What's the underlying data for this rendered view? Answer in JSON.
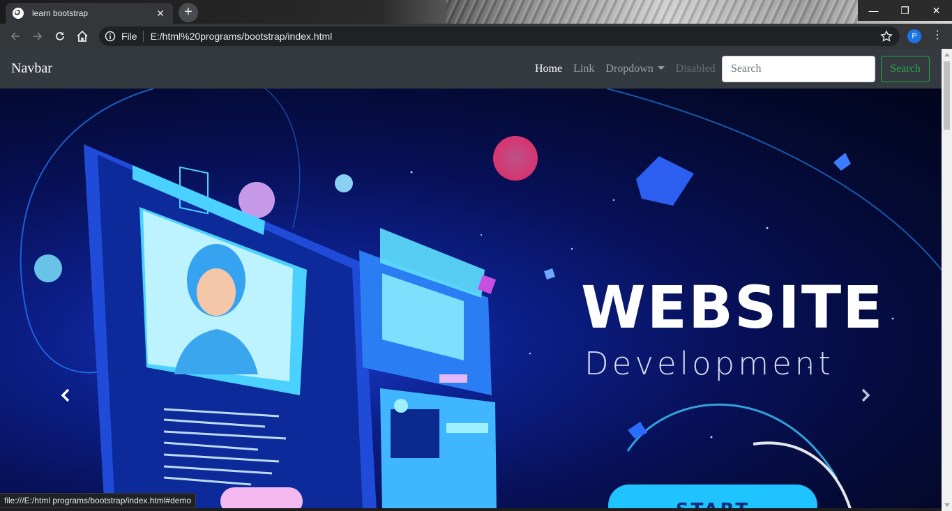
{
  "browser": {
    "tab_title": "learn bootstrap",
    "tab_close_glyph": "✕",
    "new_tab_glyph": "+",
    "scheme_label": "File",
    "url": "E:/html%20programs/bootstrap/index.html",
    "profile_initial": "P",
    "menu_glyph": "⋮",
    "window_controls": [
      "—",
      "❐",
      "✕"
    ],
    "status_url": "file:///E:/html programs/bootstrap/index.html#demo"
  },
  "navbar": {
    "brand": "Navbar",
    "links": [
      "Home",
      "Link",
      "Dropdown",
      "Disabled"
    ],
    "search_placeholder": "Search",
    "search_button": "Search"
  },
  "carousel": {
    "headline": "WEBSITE",
    "subheadline": "Development",
    "button_text": "START"
  },
  "colors": {
    "navbar_bg": "#343a40",
    "search_accent": "#28a745",
    "browser_toolbar": "#35363a"
  }
}
